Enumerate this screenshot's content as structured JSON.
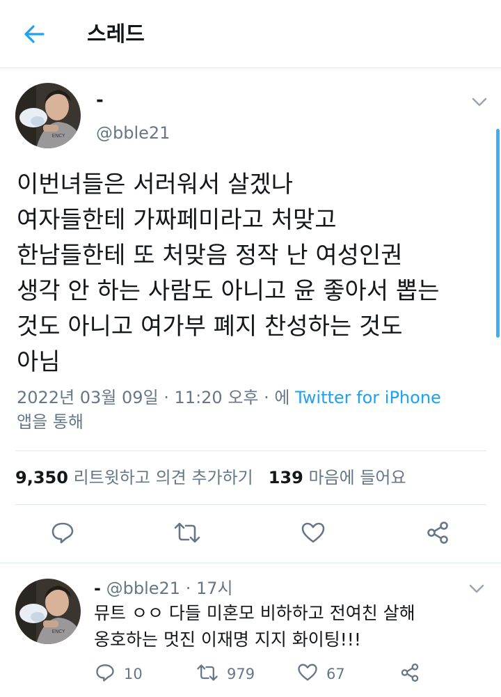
{
  "header": {
    "title": "스레드",
    "back_icon": "arrow-left-icon",
    "accent": "#1da1f2"
  },
  "tweet": {
    "name": "-",
    "handle": "@bble21",
    "lines": [
      "이번녀들은 서러워서 살겠나",
      "여자들한테 가짜페미라고 처맞고",
      "한남들한테 또 처맞음 정작 난 여성인권",
      "생각 안 하는 사람도 아니고 윤 좋아서 뽑는",
      "것도 아니고 여가부 폐지 찬성하는 것도",
      "아님"
    ],
    "meta_datetime": "2022년 03월 09일 · 11:20 오후 · 에 ",
    "meta_source": "Twitter for iPhone",
    "meta_suffix": "앱을 통해",
    "retweet_count": "9,350",
    "retweet_label": "리트윗하고 의견 추가하기",
    "like_count": "139",
    "like_label": "마음에 들어요",
    "actions": [
      "reply-icon",
      "retweet-icon",
      "like-icon",
      "share-icon"
    ]
  },
  "reply": {
    "name": "-",
    "handle": "@bble21",
    "separator": "·",
    "time": "17시",
    "lines": [
      "뮤트 ㅇㅇ 다들 미혼모 비하하고 전여친 살해",
      "옹호하는 멋진 이재명 지지 화이팅!!!"
    ],
    "reply_count": "10",
    "retweet_count": "979",
    "like_count": "67"
  }
}
